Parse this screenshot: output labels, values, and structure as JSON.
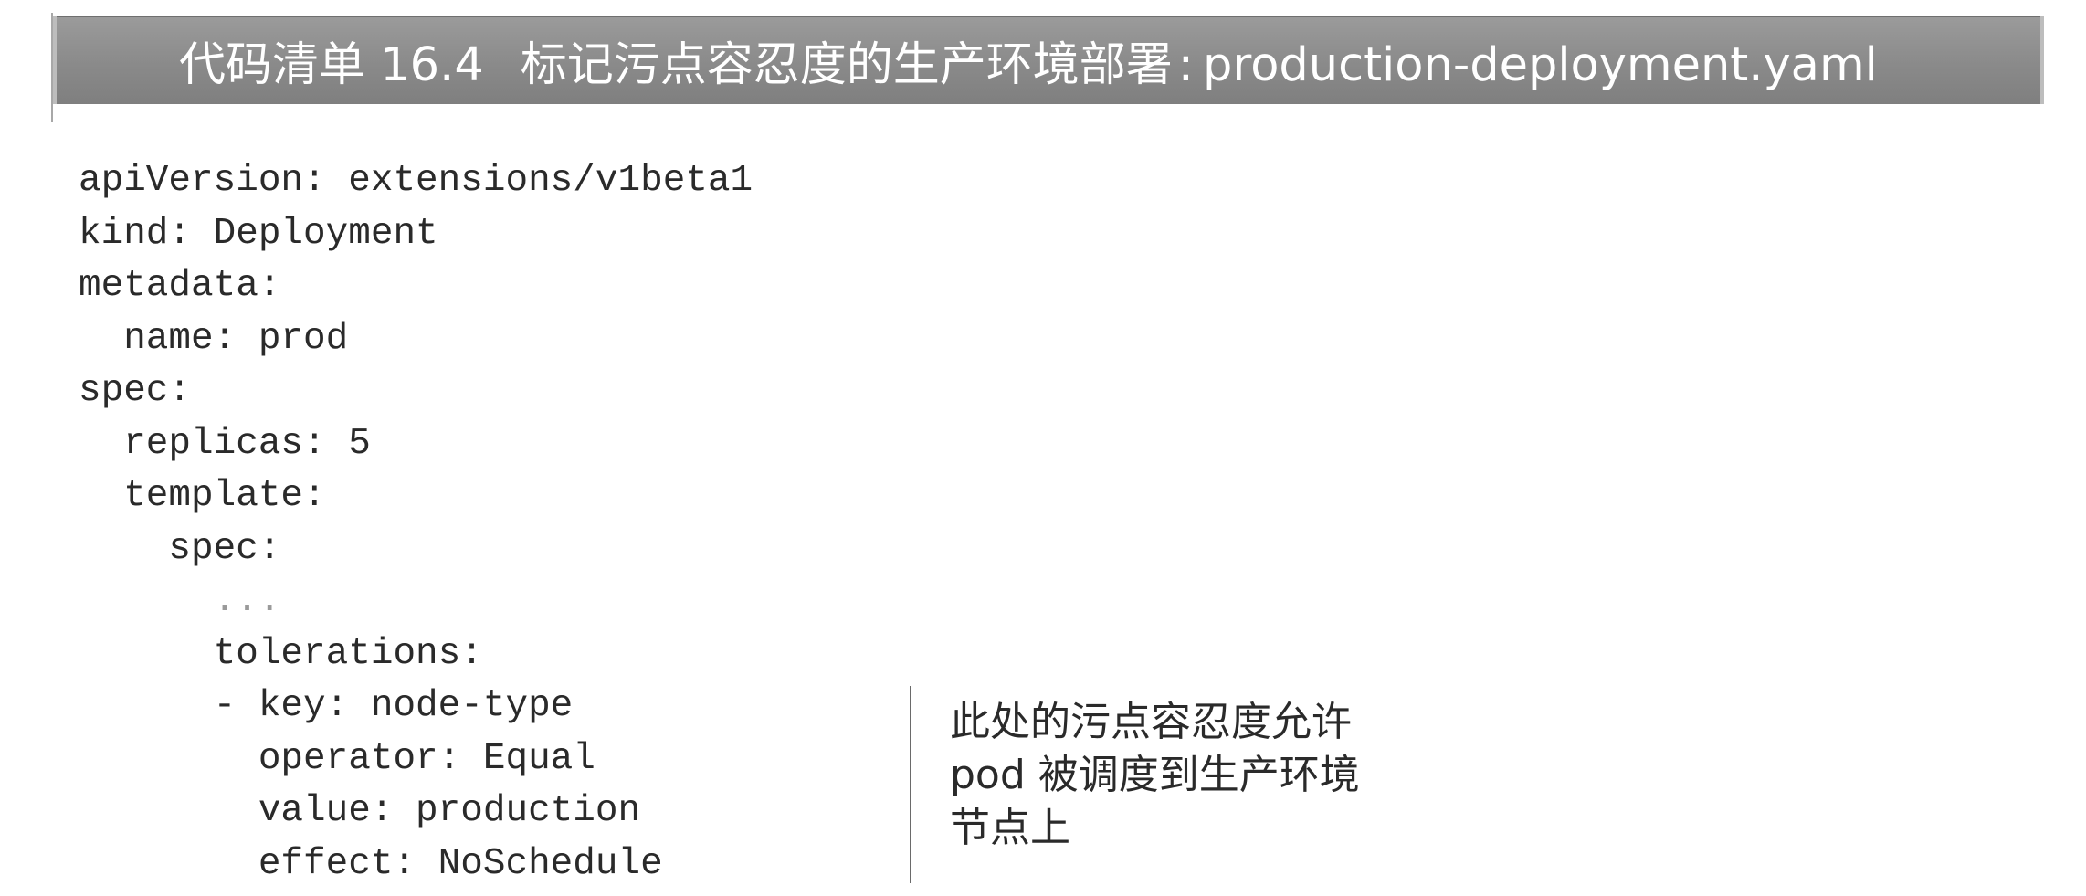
{
  "listing": {
    "label": "代码清单 16.4",
    "caption": "标记污点容忍度的生产环境部署",
    "separator": ":",
    "filename": "production-deployment.yaml"
  },
  "code": {
    "lines": [
      "apiVersion: extensions/v1beta1",
      "kind: Deployment",
      "metadata:",
      "  name: prod",
      "spec:",
      "  replicas: 5",
      "  template:",
      "    spec:",
      "      ...",
      "      tolerations:",
      "      - key: node-type",
      "        operator: Equal",
      "        value: production",
      "        effect: NoSchedule"
    ]
  },
  "annotation": {
    "lines": [
      "此处的污点容忍度允许",
      "pod 被调度到生产环境",
      "节点上"
    ]
  }
}
